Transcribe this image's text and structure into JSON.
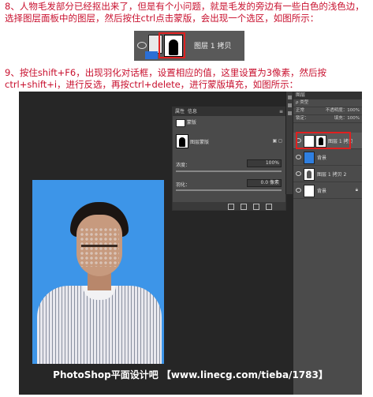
{
  "step8": {
    "text": "8、人物毛发部分已经抠出来了，但是有个小问题，就是毛发的旁边有一些白色的浅色边，选择图层面板中的图层，然后按住ctrl点击蒙版，会出现一个选区，如图所示："
  },
  "screenshot1": {
    "layer_label": "图层 1 拷贝"
  },
  "step9": {
    "text": "9、按住shift+F6，出现羽化对话框，设置相应的值，这里设置为3像素，然后按ctrl+shift+i，进行反选，再按ctrl+delete，进行蒙版填充，如图所示："
  },
  "properties_panel": {
    "tab_properties": "属性",
    "tab_info": "信息",
    "section": "蒙版",
    "mask_label": "图层蒙版",
    "density_label": "浓度：",
    "density_value": "100%",
    "feather_label": "羽化：",
    "feather_value": "0.0 像素"
  },
  "layers_panel": {
    "header": "图层",
    "filter": "ρ 类型",
    "blend_mode": "正常",
    "opacity": "不透明度：100%",
    "lock": "锁定：",
    "fill": "填充：100%",
    "layers": [
      {
        "name": "图层 1 拷贝",
        "selected": true
      },
      {
        "name": "背景"
      },
      {
        "name": "图层 1 拷贝 2"
      },
      {
        "name": "背景"
      }
    ]
  },
  "watermark": "PhotoShop平面设计吧 【www.linecg.com/tieba/1783】"
}
